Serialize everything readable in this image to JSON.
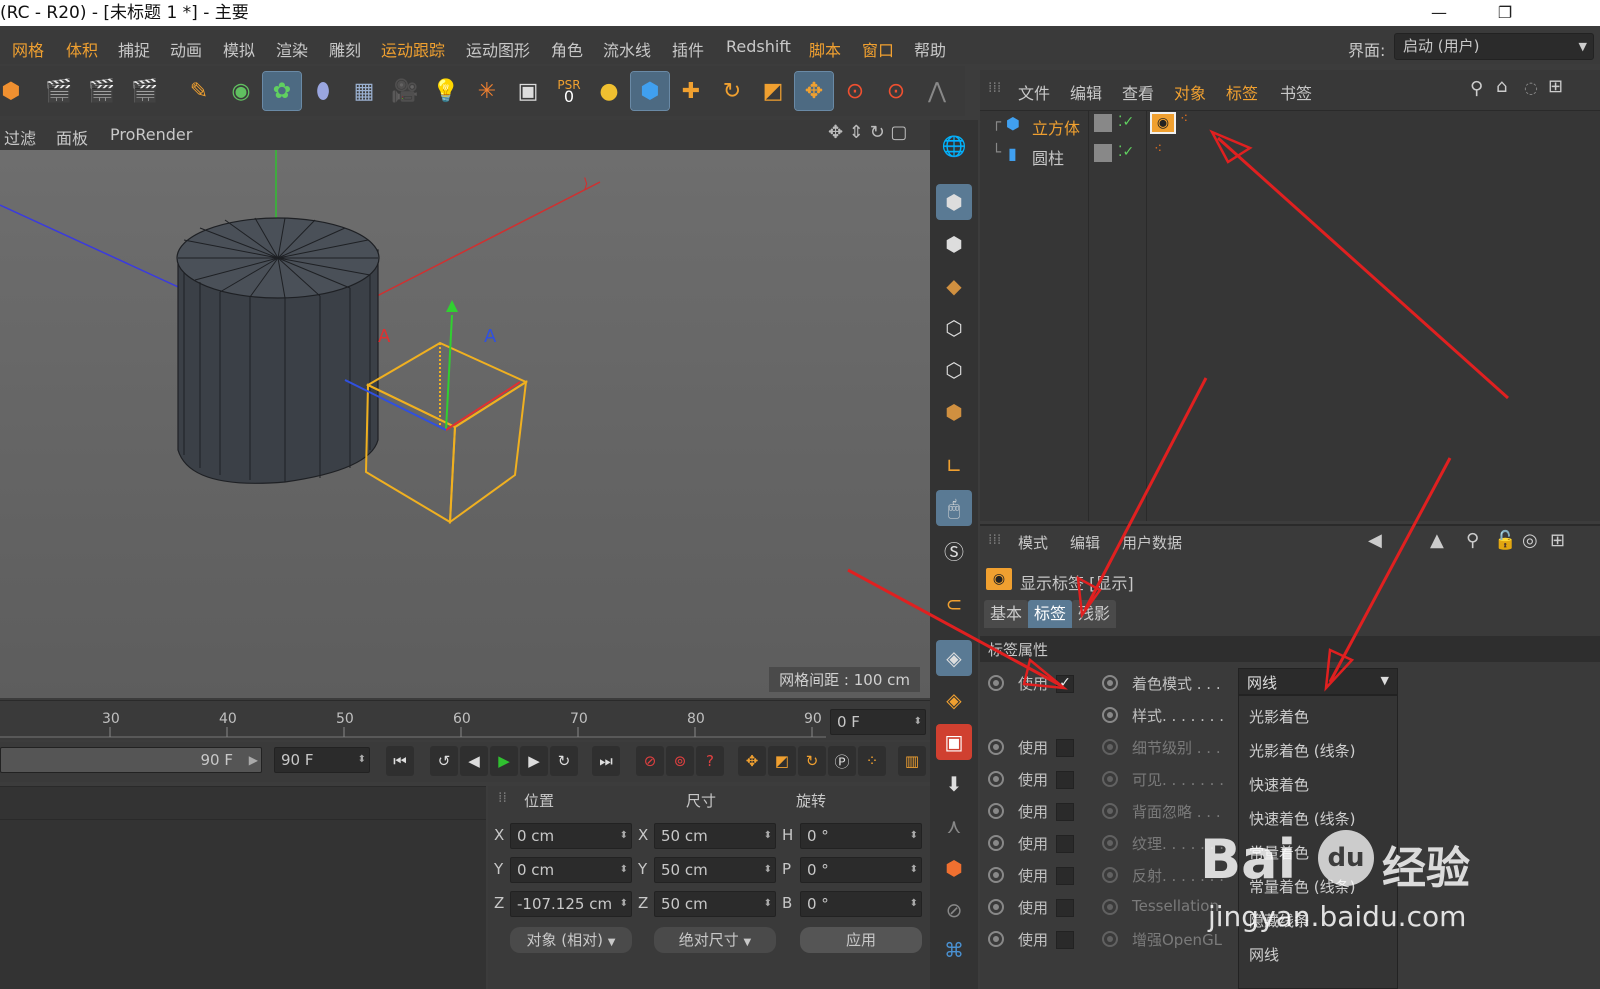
{
  "window": {
    "title": "(RC - R20) - [未标题 1 *] - 主要",
    "minimize": "—",
    "restore": "❐"
  },
  "menubar": {
    "items": [
      "网格",
      "体积",
      "捕捉",
      "动画",
      "模拟",
      "渲染",
      "雕刻",
      "运动跟踪",
      "运动图形",
      "角色",
      "流水线",
      "插件",
      "Redshift",
      "脚本",
      "窗口",
      "帮助"
    ],
    "layout_label": "界面:",
    "layout_value": "启动 (用户)"
  },
  "toolbar": {
    "psr_label": "PSR",
    "psr_value": "0"
  },
  "viewport": {
    "menu": [
      "过滤",
      "面板",
      "ProRender"
    ],
    "grid_spacing": "网格间距 : 100 cm"
  },
  "timeline": {
    "ticks": [
      "30",
      "40",
      "50",
      "60",
      "70",
      "80",
      "90"
    ],
    "current_frame": "0 F",
    "end_frame_a": "90 F",
    "end_frame_b": "90 F"
  },
  "coords": {
    "headers": [
      "位置",
      "尺寸",
      "旋转"
    ],
    "axes_pos": [
      "X",
      "Y",
      "Z"
    ],
    "axes_rot": [
      "H",
      "P",
      "B"
    ],
    "position": [
      "0 cm",
      "0 cm",
      "-107.125 cm"
    ],
    "size": [
      "50 cm",
      "50 cm",
      "50 cm"
    ],
    "rotation": [
      "0 °",
      "0 °",
      "0 °"
    ],
    "mode_dropdown": "对象 (相对)",
    "size_dropdown": "绝对尺寸",
    "apply_button": "应用"
  },
  "object_manager": {
    "menu": [
      "文件",
      "编辑",
      "查看",
      "对象",
      "标签",
      "书签"
    ],
    "objects": [
      {
        "name": "立方体",
        "selected": true
      },
      {
        "name": "圆柱",
        "selected": false
      }
    ]
  },
  "attributes": {
    "menu": [
      "模式",
      "编辑",
      "用户数据"
    ],
    "title": "显示标签 [显示]",
    "tabs": [
      "基本",
      "标签",
      "残影"
    ],
    "section": "标签属性",
    "use_label": "使用",
    "props": [
      "着色模式 . . .",
      "样式. . . . . . .",
      "细节级别 . . .",
      "可见. . . . . . .",
      "背面忽略 . . .",
      "纹理. . . . . . .",
      "反射. . . . . . .",
      "Tessellation",
      "增强OpenGL"
    ],
    "shading_value": "网线",
    "dropdown_options": [
      "光影着色",
      "光影着色 (线条)",
      "快速着色",
      "快速着色 (线条)",
      "常量着色",
      "常量着色 (线条)",
      "隐藏线条",
      "网线"
    ]
  },
  "watermark": {
    "brand": "Bai",
    "brand2": "经验",
    "url": "jingyan.baidu.com"
  },
  "colors": {
    "accent": "#f0a030",
    "selection": "#5a7a94",
    "arrow": "#e02020",
    "cube_outline": "#f0b020"
  }
}
